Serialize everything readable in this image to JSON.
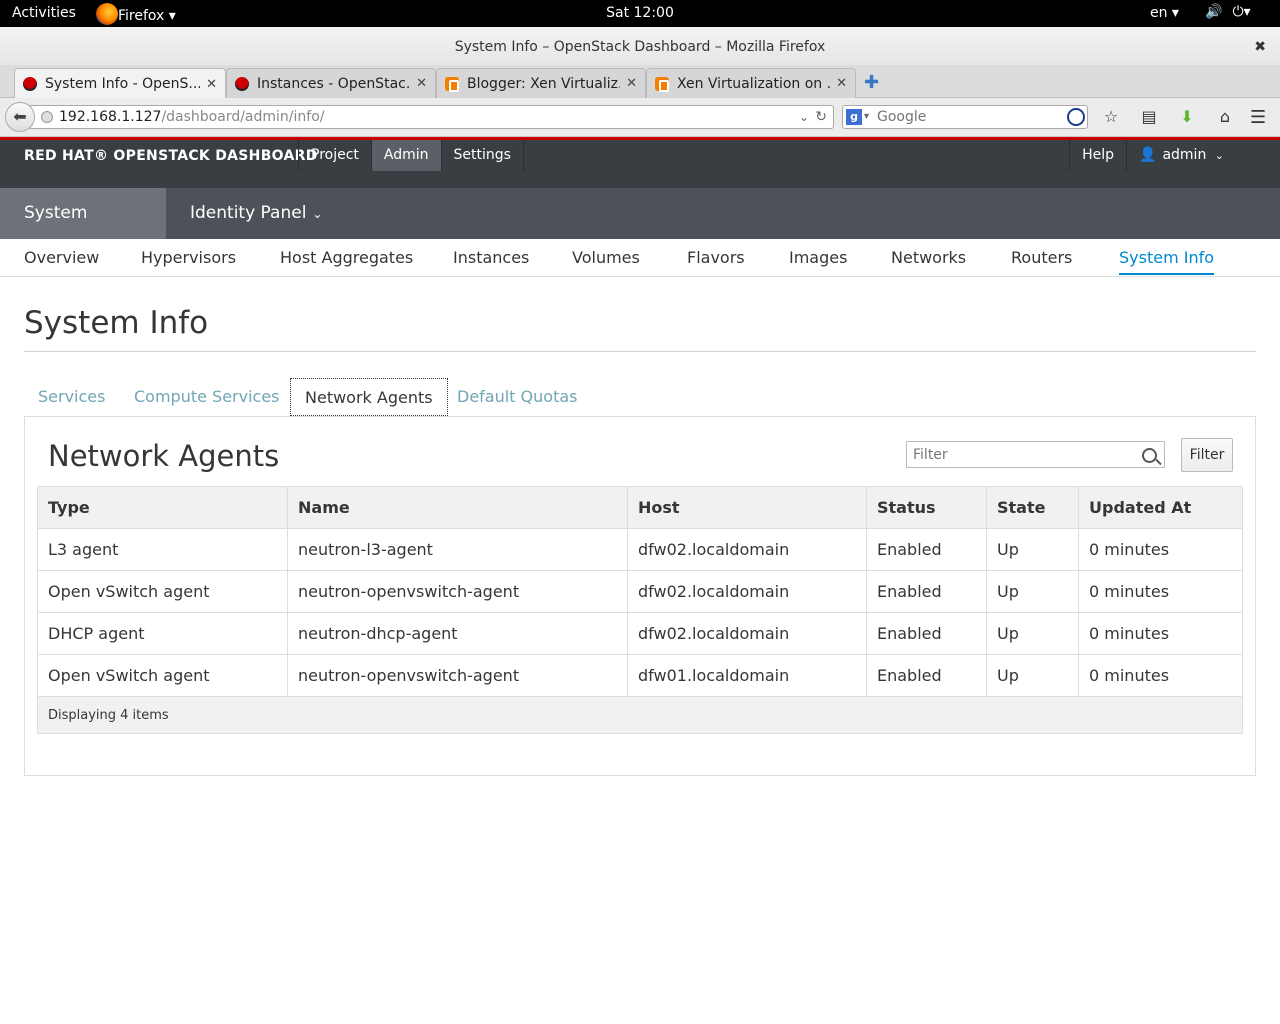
{
  "gnome": {
    "activities": "Activities",
    "app_menu": "Firefox ▾",
    "clock": "Sat 12:00",
    "lang": "en ▾"
  },
  "window": {
    "title": "System Info – OpenStack Dashboard – Mozilla Firefox"
  },
  "tabs": [
    {
      "label": "System Info - OpenS...",
      "icon": "redhat"
    },
    {
      "label": "Instances - OpenStac...",
      "icon": "redhat"
    },
    {
      "label": "Blogger: Xen Virtualiz...",
      "icon": "blogger"
    },
    {
      "label": "Xen Virtualization on ...",
      "icon": "blogger"
    }
  ],
  "urlbar": {
    "host": "192.168.1.127",
    "path": "/dashboard/admin/info/"
  },
  "search": {
    "placeholder": "Google"
  },
  "header": {
    "brand": "RED HAT® OPENSTACK DASHBOARD",
    "nav": [
      "Project",
      "Admin",
      "Settings"
    ],
    "help": "Help",
    "user": "admin"
  },
  "panels": [
    "System Panel",
    "Identity Panel"
  ],
  "subnav": [
    "Overview",
    "Hypervisors",
    "Host Aggregates",
    "Instances",
    "Volumes",
    "Flavors",
    "Images",
    "Networks",
    "Routers",
    "System Info"
  ],
  "page": {
    "title": "System Info",
    "tabs": [
      "Services",
      "Compute Services",
      "Network Agents",
      "Default Quotas"
    ]
  },
  "pane": {
    "title": "Network Agents",
    "filter_placeholder": "Filter",
    "filter_button": "Filter"
  },
  "table": {
    "columns": [
      "Type",
      "Name",
      "Host",
      "Status",
      "State",
      "Updated At"
    ],
    "rows": [
      [
        "L3 agent",
        "neutron-l3-agent",
        "dfw02.localdomain",
        "Enabled",
        "Up",
        "0 minutes"
      ],
      [
        "Open vSwitch agent",
        "neutron-openvswitch-agent",
        "dfw02.localdomain",
        "Enabled",
        "Up",
        "0 minutes"
      ],
      [
        "DHCP agent",
        "neutron-dhcp-agent",
        "dfw02.localdomain",
        "Enabled",
        "Up",
        "0 minutes"
      ],
      [
        "Open vSwitch agent",
        "neutron-openvswitch-agent",
        "dfw01.localdomain",
        "Enabled",
        "Up",
        "0 minutes"
      ]
    ],
    "footer": "Displaying 4 items"
  },
  "colors": {
    "accent": "#0088ce",
    "brand_red": "#cc0000",
    "header_bg": "#393e43"
  }
}
